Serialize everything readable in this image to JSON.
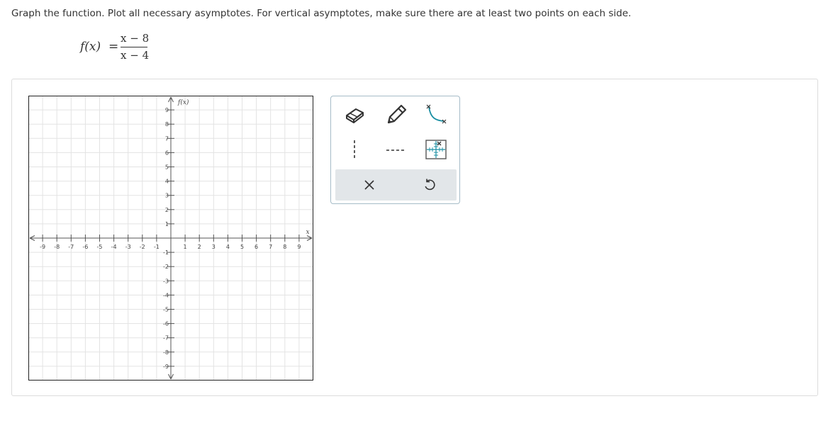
{
  "prompt": "Graph the function. Plot all necessary asymptotes. For vertical asymptotes, make sure there are at least two points on each side.",
  "function": {
    "lhs": "f(x)",
    "equals": "=",
    "numerator": "x − 8",
    "denominator": "x − 4"
  },
  "graph": {
    "x_axis_label": "x",
    "y_axis_label": "f(x)",
    "x_range": [
      -10,
      10
    ],
    "y_range": [
      -10,
      10
    ],
    "grid": true,
    "x_ticks": [
      "-9",
      "-8",
      "-7",
      "-6",
      "-5",
      "-4",
      "-3",
      "-2",
      "-1",
      "1",
      "2",
      "3",
      "4",
      "5",
      "6",
      "7",
      "8",
      "9"
    ],
    "y_ticks": [
      "9",
      "8",
      "7",
      "6",
      "5",
      "4",
      "3",
      "2",
      "1",
      "-1",
      "-2",
      "-3",
      "-4",
      "-5",
      "-6",
      "-7",
      "-8",
      "-9"
    ]
  },
  "tools": [
    {
      "name": "eraser-tool",
      "icon": "eraser-icon"
    },
    {
      "name": "pencil-tool",
      "icon": "pencil-icon"
    },
    {
      "name": "curve-tool",
      "icon": "curve-icon"
    },
    {
      "name": "vertical-asymptote-tool",
      "icon": "vertical-dashed-line-icon"
    },
    {
      "name": "horizontal-asymptote-tool",
      "icon": "horizontal-dashed-line-icon"
    },
    {
      "name": "point-grid-tool",
      "icon": "point-grid-icon"
    }
  ],
  "actions": [
    {
      "name": "clear-button",
      "icon": "close-icon"
    },
    {
      "name": "reset-button",
      "icon": "undo-icon"
    }
  ],
  "colors": {
    "accent": "#1a8fa3",
    "toolbox_border": "#a6bcc8",
    "action_bar": "#e2e6e9",
    "grid": "#e3e3e3",
    "axis": "#555555"
  }
}
